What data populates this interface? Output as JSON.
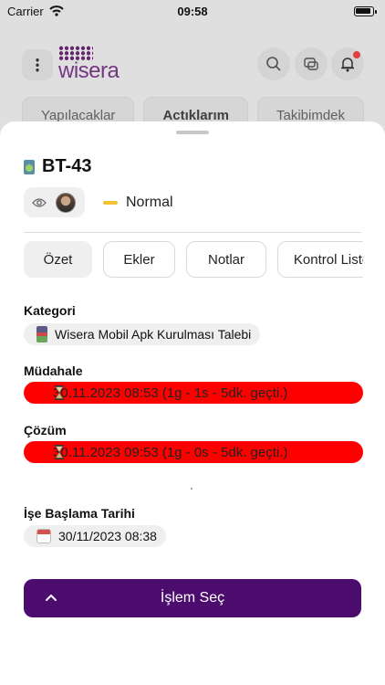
{
  "status_bar": {
    "carrier": "Carrier",
    "time": "09:58"
  },
  "app": {
    "logo_text": "wisera",
    "brand_color": "#4c0c6e",
    "background_tabs": [
      "Yapılacaklar",
      "Actıklarım",
      "Takibimdek"
    ]
  },
  "ticket": {
    "code": "BT-43",
    "priority": "Normal",
    "priority_color": "#f2c230"
  },
  "tabs": [
    {
      "label": "Özet",
      "active": true
    },
    {
      "label": "Ekler",
      "active": false
    },
    {
      "label": "Notlar",
      "active": false
    },
    {
      "label": "Kontrol Listesi",
      "active": false
    }
  ],
  "fields": {
    "category_label": "Kategori",
    "category_value": "Wisera Mobil Apk Kurulması Talebi",
    "intervention_label": "Müdahale",
    "intervention_value": "30.11.2023 08:53 (1g - 1s - 5dk. geçti.)",
    "solution_label": "Çözüm",
    "solution_value": "30.11.2023 09:53 (1g - 0s - 5dk. geçti.)",
    "start_label": "İşe Başlama Tarihi",
    "start_value": "30/11/2023 08:38",
    "overdue_color": "#ff0000"
  },
  "action_button": {
    "label": "İşlem Seç"
  }
}
